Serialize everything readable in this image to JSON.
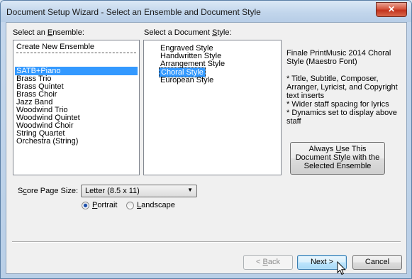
{
  "window": {
    "title": "Document Setup Wizard - Select an Ensemble and Document Style",
    "close_glyph": "✕"
  },
  "ensemble": {
    "label_before": "Select an ",
    "label_accel": "E",
    "label_after": "nsemble:",
    "items": [
      "Create New Ensemble",
      "SATB+Piano",
      "Brass Trio",
      "Brass Quintet",
      "Brass Choir",
      "Jazz Band",
      "Woodwind Trio",
      "Woodwind Quintet",
      "Woodwind Choir",
      "String Quartet",
      "Orchestra (String)"
    ],
    "selected": "SATB+Piano"
  },
  "style": {
    "label_before": "Select a Document ",
    "label_accel": "S",
    "label_after": "tyle:",
    "items": [
      "Engraved Style",
      "Handwritten Style",
      "Arrangement Style",
      "Choral Style",
      "European Style"
    ],
    "selected": "Choral Style"
  },
  "description": {
    "heading": "Finale PrintMusic 2014 Choral Style (Maestro Font)",
    "bullets": "* Title, Subtitle, Composer, Arranger, Lyricist, and Copyright text inserts\n* Wider staff spacing for lyrics\n* Dynamics set to display above staff"
  },
  "always_use_button": {
    "before": "Always ",
    "accel": "U",
    "after": "se This Document Style with the Selected Ensemble"
  },
  "page_size": {
    "label_before": "S",
    "label_accel": "c",
    "label_after": "ore Page Size:",
    "value": "Letter (8.5 x 11)",
    "arrow": "▼"
  },
  "orientation": {
    "portrait_accel": "P",
    "portrait_rest": "ortrait",
    "landscape_accel": "L",
    "landscape_rest": "andscape",
    "selected": "Portrait"
  },
  "footer": {
    "back_before": "< ",
    "back_accel": "B",
    "back_after": "ack",
    "next": "Next >",
    "cancel": "Cancel"
  },
  "icons": {
    "close": "close-icon",
    "dropdown": "chevron-down-icon",
    "cursor": "mouse-pointer-icon"
  }
}
